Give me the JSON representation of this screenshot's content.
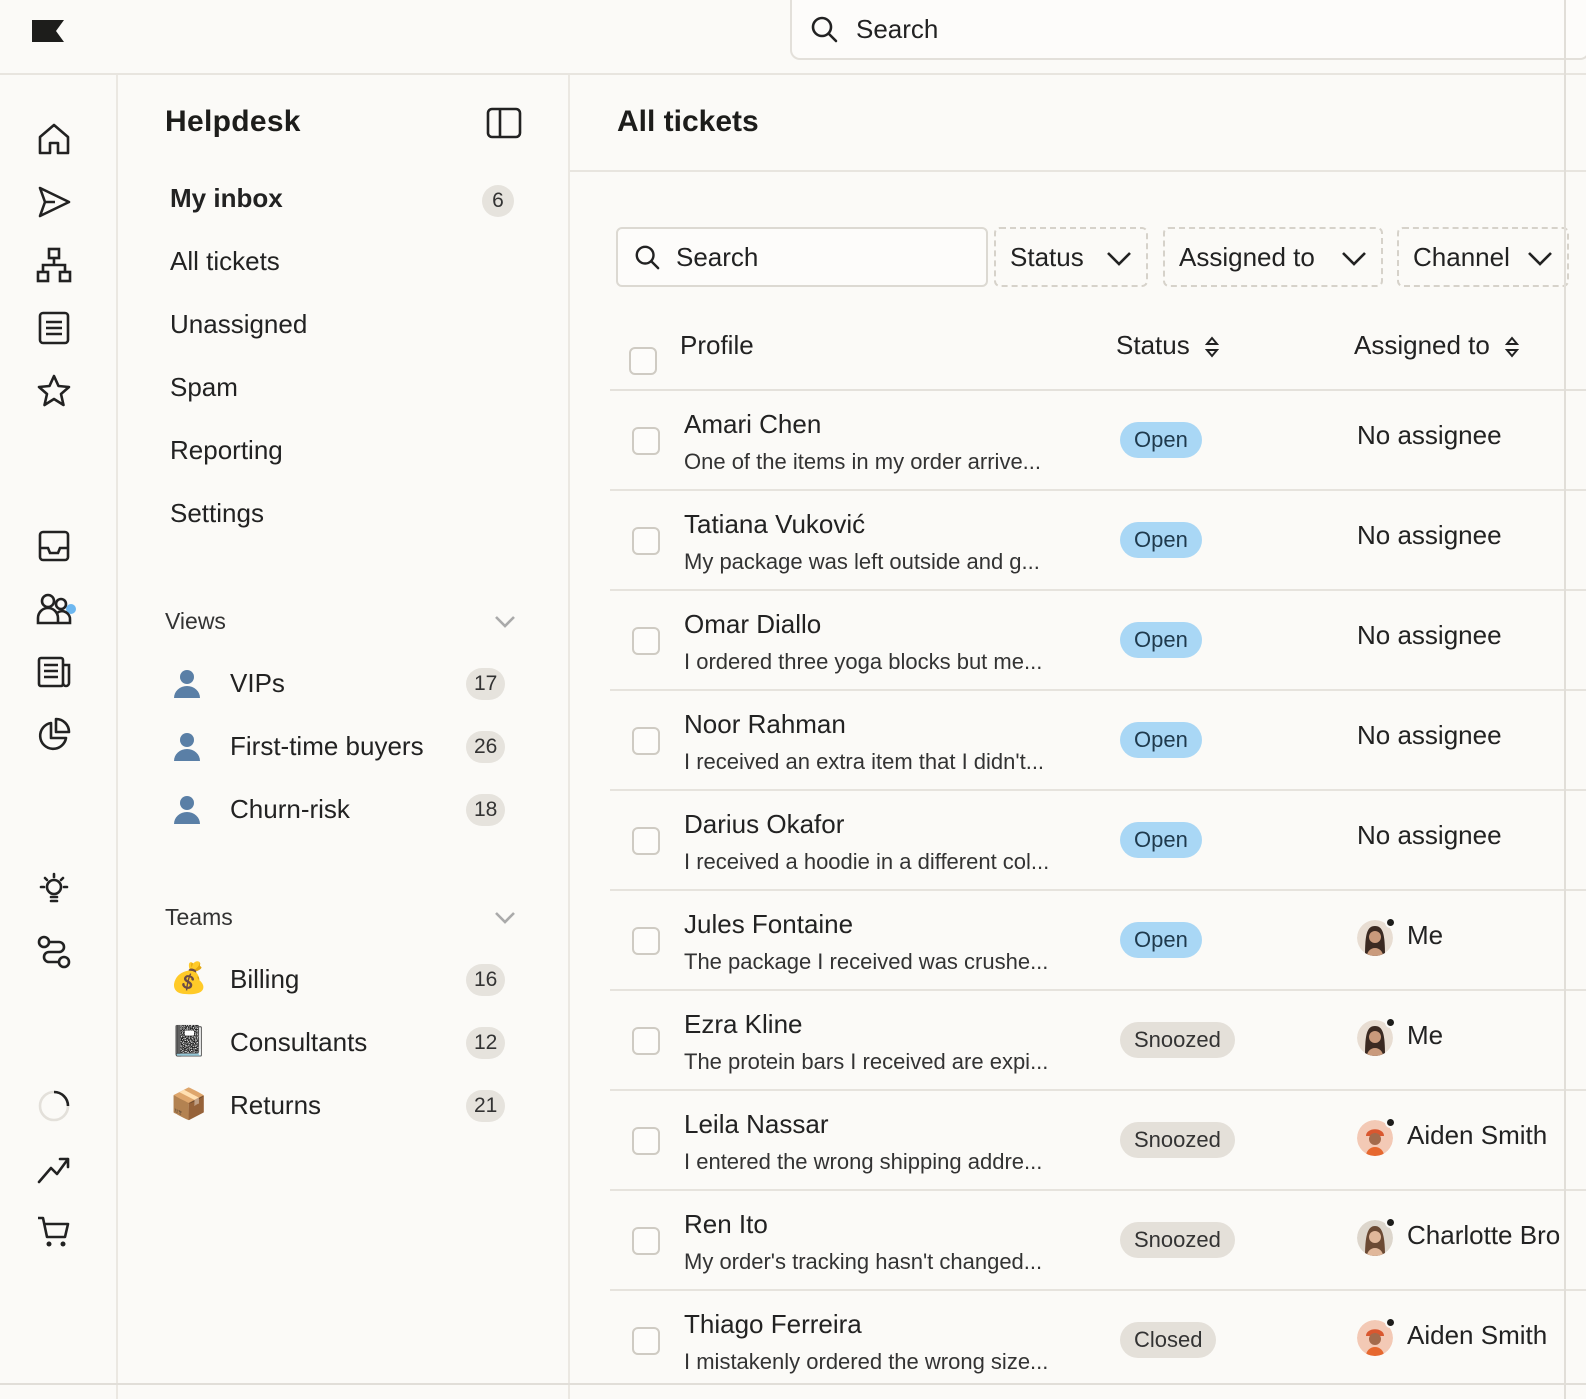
{
  "global_search": {
    "placeholder": "Search"
  },
  "sidebar": {
    "title": "Helpdesk",
    "nav": [
      {
        "label": "My inbox",
        "count": "6",
        "active": true
      },
      {
        "label": "All tickets"
      },
      {
        "label": "Unassigned"
      },
      {
        "label": "Spam"
      },
      {
        "label": "Reporting"
      },
      {
        "label": "Settings"
      }
    ],
    "views_title": "Views",
    "views": [
      {
        "label": "VIPs",
        "count": "17",
        "icon": "person-icon"
      },
      {
        "label": "First-time buyers",
        "count": "26",
        "icon": "person-icon"
      },
      {
        "label": "Churn-risk",
        "count": "18",
        "icon": "person-icon"
      }
    ],
    "teams_title": "Teams",
    "teams": [
      {
        "label": "Billing",
        "count": "16",
        "icon": "money-bag-icon",
        "glyph": "💰"
      },
      {
        "label": "Consultants",
        "count": "12",
        "icon": "notebook-icon",
        "glyph": "📓"
      },
      {
        "label": "Returns",
        "count": "21",
        "icon": "package-icon",
        "glyph": "📦"
      }
    ]
  },
  "main": {
    "title": "All tickets",
    "search_placeholder": "Search",
    "filters": {
      "status": "Status",
      "assigned_to": "Assigned to",
      "channel": "Channel"
    },
    "columns": {
      "profile": "Profile",
      "status": "Status",
      "assigned_to": "Assigned to"
    },
    "rows": [
      {
        "name": "Amari Chen",
        "message": "One of the items in my order arrive...",
        "status": "Open",
        "assignee": "No assignee"
      },
      {
        "name": "Tatiana Vuković",
        "message": "My package was left outside and g...",
        "status": "Open",
        "assignee": "No assignee"
      },
      {
        "name": "Omar Diallo",
        "message": "I ordered three yoga blocks but me...",
        "status": "Open",
        "assignee": "No assignee"
      },
      {
        "name": "Noor Rahman",
        "message": "I received an extra item that I didn't...",
        "status": "Open",
        "assignee": "No assignee"
      },
      {
        "name": "Darius Okafor",
        "message": "I received a hoodie in a different col...",
        "status": "Open",
        "assignee": "No assignee"
      },
      {
        "name": "Jules Fontaine",
        "message": "The package I received was crushe...",
        "status": "Open",
        "assignee": "Me"
      },
      {
        "name": "Ezra Kline",
        "message": "The protein bars I received are expi...",
        "status": "Snoozed",
        "assignee": "Me"
      },
      {
        "name": "Leila Nassar",
        "message": "I entered the wrong shipping addre...",
        "status": "Snoozed",
        "assignee": "Aiden Smith"
      },
      {
        "name": "Ren Ito",
        "message": "My order's tracking hasn't changed...",
        "status": "Snoozed",
        "assignee": "Charlotte Bro"
      },
      {
        "name": "Thiago Ferreira",
        "message": "I mistakenly ordered the wrong size...",
        "status": "Closed",
        "assignee": "Aiden Smith"
      }
    ]
  },
  "colors": {
    "open_pill": "#a9d7f5",
    "neutral_pill": "#e4e0d9",
    "notification_dot": "#6db7f0"
  }
}
